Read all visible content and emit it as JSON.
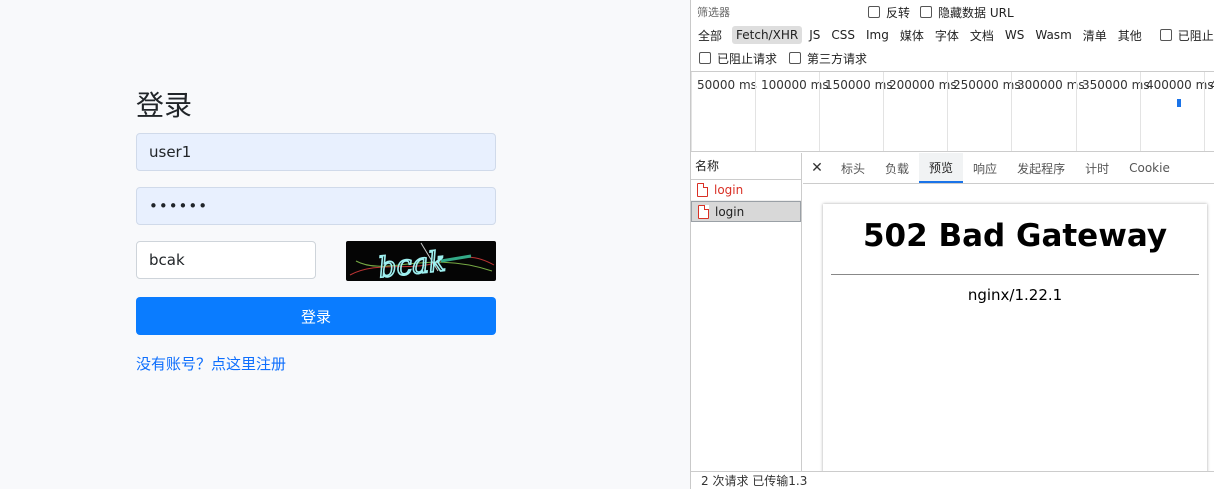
{
  "login": {
    "title": "登录",
    "username_value": "user1",
    "password_value": "••••••",
    "captcha_value": "bcak",
    "captcha_image_text": "bcak",
    "submit_label": "登录",
    "register_link": "没有账号？点这里注册"
  },
  "devtools": {
    "filter_placeholder": "筛选器",
    "invert_label": "反转",
    "hide_data_url_label": "隐藏数据 URL",
    "types": [
      "全部",
      "Fetch/XHR",
      "JS",
      "CSS",
      "Img",
      "媒体",
      "字体",
      "文档",
      "WS",
      "Wasm",
      "清单",
      "其他"
    ],
    "active_type": "Fetch/XHR",
    "blocked_cookies_label": "已阻止 Cookie",
    "blocked_requests_label": "已阻止请求",
    "third_party_label": "第三方请求",
    "timeline_ticks": [
      "50000 ms",
      "100000 ms",
      "150000 ms",
      "200000 ms",
      "250000 ms",
      "300000 ms",
      "350000 ms",
      "400000 ms",
      "4"
    ],
    "name_header": "名称",
    "requests": [
      {
        "name": "login",
        "status": "error"
      },
      {
        "name": "login",
        "status": "selected"
      }
    ],
    "status_text": "2 次请求  已传输1.3",
    "tabs": [
      "标头",
      "负载",
      "预览",
      "响应",
      "发起程序",
      "计时",
      "Cookie"
    ],
    "active_tab": "预览",
    "preview": {
      "heading": "502 Bad Gateway",
      "server": "nginx/1.22.1"
    },
    "colors": {
      "accent": "#1a73e8",
      "error": "#d93025"
    }
  }
}
